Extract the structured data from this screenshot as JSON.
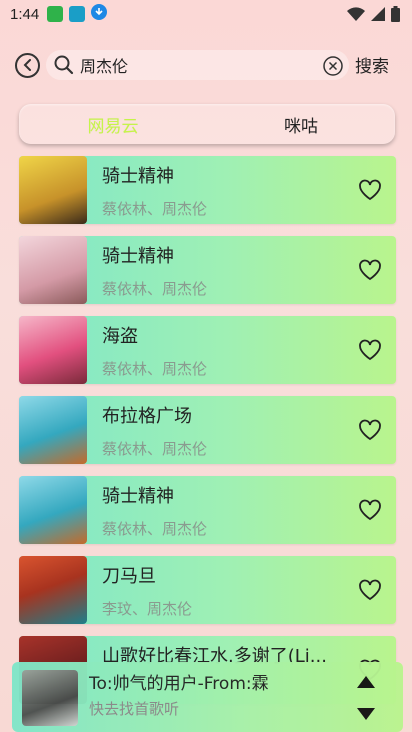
{
  "status_bar": {
    "time": "1:44"
  },
  "search": {
    "query": "周杰伦",
    "placeholder": "",
    "search_label": "搜索"
  },
  "tabs": [
    {
      "label": "网易云",
      "active": true
    },
    {
      "label": "咪咕",
      "active": false
    }
  ],
  "songs": [
    {
      "title": "骑士精神",
      "artist": "蔡依林、周杰伦",
      "cover_color": "#e0c13a"
    },
    {
      "title": "骑士精神",
      "artist": "蔡依林、周杰伦",
      "cover_color": "#e8b7c2"
    },
    {
      "title": "海盗",
      "artist": "蔡依林、周杰伦",
      "cover_color": "#e25f8b"
    },
    {
      "title": "布拉格广场",
      "artist": "蔡依林、周杰伦",
      "cover_color": "#3fb6c9"
    },
    {
      "title": "骑士精神",
      "artist": "蔡依林、周杰伦",
      "cover_color": "#3fb6c9"
    },
    {
      "title": "刀马旦",
      "artist": "李玟、周杰伦",
      "cover_color": "#c84a2f"
    },
    {
      "title": "山歌好比春江水.多谢了(Li...",
      "artist": "",
      "cover_color": "#8a2d2a"
    }
  ],
  "now_playing": {
    "title": "To:帅气的用户-From:霖",
    "subtitle": "快去找首歌听"
  },
  "colors": {
    "active_tab": "#c6f44a",
    "card_start": "#7fe6c9",
    "card_end": "#b9f48d"
  }
}
